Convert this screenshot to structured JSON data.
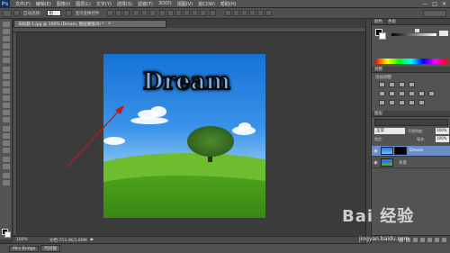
{
  "app": {
    "logo": "Ps",
    "menus": [
      "文件(F)",
      "编辑(E)",
      "图像(I)",
      "图层(L)",
      "文字(Y)",
      "选择(S)",
      "滤镜(T)",
      "3D(D)",
      "视图(V)",
      "窗口(W)",
      "帮助(H)"
    ],
    "window_controls": [
      "—",
      "□",
      "✕"
    ]
  },
  "options_bar": {
    "auto_select_label": "自动选择：",
    "auto_select_value": "组",
    "show_transform_label": "显示变换控件"
  },
  "document": {
    "tab_title": "未标题-1.jpg @ 100% (Dream, 图层蒙版/8) *",
    "image_text": "Dream"
  },
  "status": {
    "zoom": "100%",
    "doc_size": "文档:753.4K/1.89M"
  },
  "bottom_tabs": [
    "Mini Bridge",
    "时间轴"
  ],
  "right_panels": {
    "color_header": "颜色",
    "swatches_header": "色板",
    "adjustments_header": "调整",
    "add_adjustment": "添加调整",
    "layers_header": "图层",
    "blend_mode": "正常",
    "opacity_label": "不透明度：",
    "opacity_value": "100%",
    "lock_label": "锁定：",
    "fill_label": "填充：",
    "fill_value": "100%",
    "layers": [
      {
        "name": "Dream",
        "visible": true
      },
      {
        "name": "背景",
        "visible": true
      }
    ]
  },
  "watermark": {
    "text": "Bai 经验",
    "url": "jingyan.baidu.com"
  },
  "colors": {
    "ui_dark": "#3d3d3d",
    "panel": "#535353",
    "arrow": "#c0161e"
  }
}
